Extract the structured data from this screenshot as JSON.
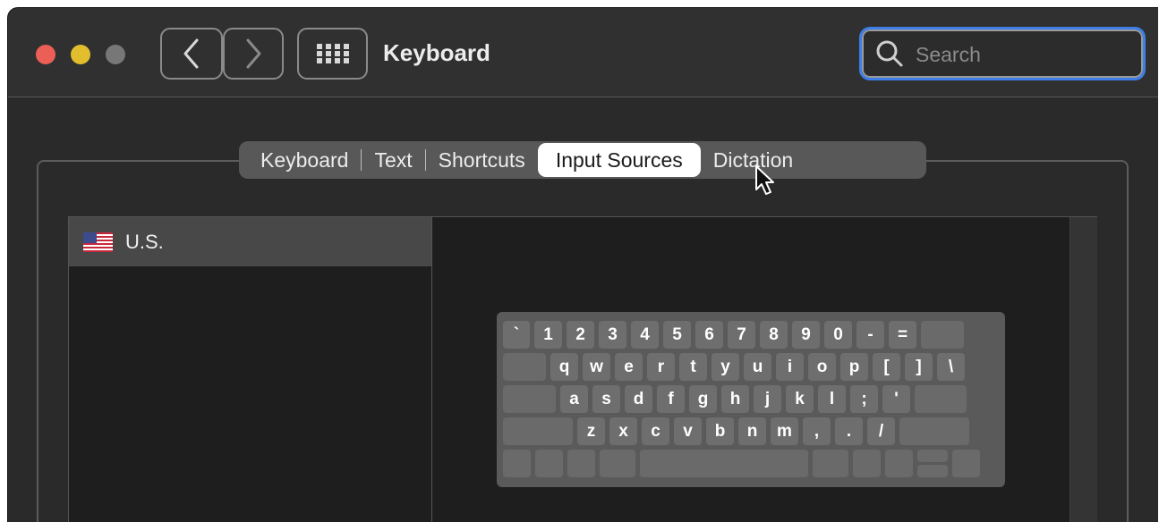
{
  "window": {
    "title": "Keyboard",
    "traffic_colors": {
      "close": "#ec5f57",
      "minimize": "#e2bd2e",
      "zoom": "#777777"
    }
  },
  "search": {
    "placeholder": "Search",
    "accent": "#3d7ee8"
  },
  "icons": {
    "back": "chevron-left-icon",
    "forward": "chevron-right-icon",
    "grid": "grid-icon",
    "search": "magnifier-icon",
    "flag": "us-flag-icon"
  },
  "tabs": [
    {
      "label": "Keyboard",
      "active": false
    },
    {
      "label": "Text",
      "active": false
    },
    {
      "label": "Shortcuts",
      "active": false
    },
    {
      "label": "Input Sources",
      "active": true
    },
    {
      "label": "Dictation",
      "active": false
    }
  ],
  "input_sources": [
    {
      "label": "U.S."
    }
  ],
  "keyboard_rows": [
    [
      "`",
      "1",
      "2",
      "3",
      "4",
      "5",
      "6",
      "7",
      "8",
      "9",
      "0",
      "-",
      "="
    ],
    [
      "q",
      "w",
      "e",
      "r",
      "t",
      "y",
      "u",
      "i",
      "o",
      "p",
      "[",
      "]",
      "\\"
    ],
    [
      "a",
      "s",
      "d",
      "f",
      "g",
      "h",
      "j",
      "k",
      "l",
      ";",
      "'"
    ],
    [
      "z",
      "x",
      "c",
      "v",
      "b",
      "n",
      "m",
      ",",
      ".",
      "/"
    ]
  ]
}
